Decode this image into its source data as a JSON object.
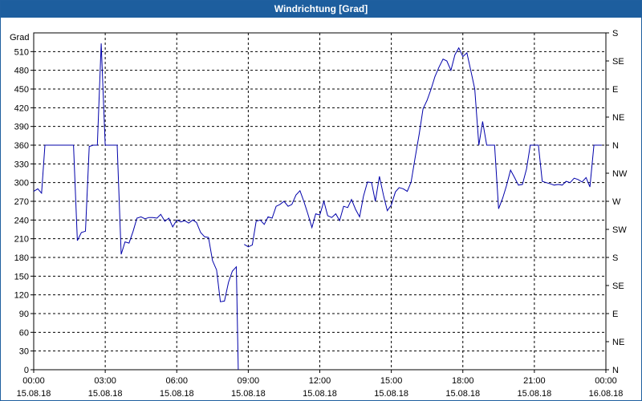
{
  "window": {
    "title": "Windrichtung [Grad]"
  },
  "colors": {
    "titlebar": "#1d5e9e",
    "line": "#0000aa",
    "grid": "#000000"
  },
  "chart_data": {
    "type": "line",
    "title": "Windrichtung [Grad]",
    "ylabel": "Grad",
    "ylim": [
      0,
      540
    ],
    "xlim": [
      0,
      24
    ],
    "grid": true,
    "y_ticks": [
      0,
      30,
      60,
      90,
      120,
      150,
      180,
      210,
      240,
      270,
      300,
      330,
      360,
      390,
      420,
      450,
      480,
      510
    ],
    "right_ticks": [
      {
        "value": 0,
        "label": "N"
      },
      {
        "value": 45,
        "label": "NE"
      },
      {
        "value": 90,
        "label": "E"
      },
      {
        "value": 135,
        "label": "SE"
      },
      {
        "value": 180,
        "label": "S"
      },
      {
        "value": 225,
        "label": "SW"
      },
      {
        "value": 270,
        "label": "W"
      },
      {
        "value": 315,
        "label": "NW"
      },
      {
        "value": 360,
        "label": "N"
      },
      {
        "value": 405,
        "label": "NE"
      },
      {
        "value": 450,
        "label": "E"
      },
      {
        "value": 495,
        "label": "SE"
      },
      {
        "value": 540,
        "label": "S"
      }
    ],
    "x_ticks": [
      {
        "value": 0,
        "time": "00:00",
        "date": "15.08.18"
      },
      {
        "value": 3,
        "time": "03:00",
        "date": "15.08.18"
      },
      {
        "value": 6,
        "time": "06:00",
        "date": "15.08.18"
      },
      {
        "value": 9,
        "time": "09:00",
        "date": "15.08.18"
      },
      {
        "value": 12,
        "time": "12:00",
        "date": "15.08.18"
      },
      {
        "value": 15,
        "time": "15:00",
        "date": "15.08.18"
      },
      {
        "value": 18,
        "time": "18:00",
        "date": "15.08.18"
      },
      {
        "value": 21,
        "time": "21:00",
        "date": "15.08.18"
      },
      {
        "value": 24,
        "time": "00:00",
        "date": "16.08.18"
      }
    ],
    "series": [
      {
        "segments": [
          [
            [
              0.0,
              286
            ],
            [
              0.17,
              290
            ],
            [
              0.33,
              283
            ],
            [
              0.47,
              360
            ],
            [
              0.67,
              360
            ],
            [
              1.0,
              360
            ],
            [
              1.33,
              360
            ],
            [
              1.67,
              360
            ],
            [
              1.83,
              207
            ],
            [
              2.0,
              220
            ],
            [
              2.17,
              222
            ],
            [
              2.33,
              358
            ],
            [
              2.5,
              360
            ],
            [
              2.67,
              360
            ],
            [
              2.83,
              523
            ],
            [
              3.0,
              360
            ],
            [
              3.17,
              360
            ],
            [
              3.33,
              360
            ],
            [
              3.5,
              360
            ],
            [
              3.67,
              185
            ],
            [
              3.83,
              205
            ],
            [
              4.0,
              203
            ],
            [
              4.17,
              222
            ],
            [
              4.33,
              243
            ],
            [
              4.5,
              245
            ],
            [
              4.67,
              242
            ],
            [
              4.83,
              244
            ],
            [
              5.0,
              244
            ],
            [
              5.17,
              243
            ],
            [
              5.33,
              249
            ],
            [
              5.5,
              238
            ],
            [
              5.67,
              243
            ],
            [
              5.83,
              229
            ],
            [
              6.0,
              240
            ],
            [
              6.17,
              237
            ],
            [
              6.33,
              239
            ],
            [
              6.5,
              235
            ],
            [
              6.67,
              240
            ],
            [
              6.83,
              236
            ],
            [
              7.0,
              220
            ],
            [
              7.17,
              213
            ],
            [
              7.33,
              212
            ],
            [
              7.5,
              175
            ],
            [
              7.67,
              160
            ],
            [
              7.83,
              109
            ],
            [
              8.0,
              110
            ],
            [
              8.17,
              140
            ],
            [
              8.33,
              158
            ],
            [
              8.5,
              165
            ],
            [
              8.58,
              0
            ]
          ],
          [
            [
              8.83,
              201
            ],
            [
              9.0,
              197
            ],
            [
              9.17,
              200
            ],
            [
              9.33,
              238
            ],
            [
              9.5,
              240
            ],
            [
              9.67,
              233
            ],
            [
              9.83,
              245
            ],
            [
              10.0,
              243
            ],
            [
              10.17,
              262
            ],
            [
              10.33,
              265
            ],
            [
              10.5,
              270
            ],
            [
              10.67,
              262
            ],
            [
              10.83,
              265
            ],
            [
              11.0,
              280
            ],
            [
              11.17,
              287
            ],
            [
              11.33,
              270
            ],
            [
              11.5,
              250
            ],
            [
              11.67,
              228
            ],
            [
              11.83,
              250
            ],
            [
              12.0,
              248
            ],
            [
              12.17,
              270
            ],
            [
              12.33,
              247
            ],
            [
              12.5,
              244
            ],
            [
              12.67,
              250
            ],
            [
              12.83,
              239
            ],
            [
              13.0,
              262
            ],
            [
              13.17,
              260
            ],
            [
              13.33,
              273
            ],
            [
              13.5,
              257
            ],
            [
              13.67,
              245
            ],
            [
              13.83,
              278
            ],
            [
              14.0,
              301
            ],
            [
              14.17,
              300
            ],
            [
              14.33,
              270
            ],
            [
              14.5,
              310
            ],
            [
              14.67,
              280
            ],
            [
              14.83,
              255
            ],
            [
              15.0,
              264
            ],
            [
              15.17,
              285
            ],
            [
              15.33,
              292
            ],
            [
              15.5,
              290
            ],
            [
              15.67,
              286
            ],
            [
              15.83,
              301
            ],
            [
              16.0,
              340
            ],
            [
              16.17,
              378
            ],
            [
              16.33,
              418
            ],
            [
              16.5,
              432
            ],
            [
              16.67,
              450
            ],
            [
              16.83,
              470
            ],
            [
              17.0,
              485
            ],
            [
              17.17,
              498
            ],
            [
              17.33,
              495
            ],
            [
              17.5,
              480
            ],
            [
              17.67,
              505
            ],
            [
              17.83,
              516
            ],
            [
              18.0,
              502
            ],
            [
              18.17,
              508
            ],
            [
              18.33,
              480
            ],
            [
              18.5,
              450
            ],
            [
              18.67,
              360
            ],
            [
              18.83,
              398
            ],
            [
              19.0,
              360
            ],
            [
              19.17,
              360
            ],
            [
              19.33,
              360
            ],
            [
              19.5,
              258
            ],
            [
              19.67,
              275
            ],
            [
              19.83,
              295
            ],
            [
              20.0,
              320
            ],
            [
              20.17,
              308
            ],
            [
              20.33,
              296
            ],
            [
              20.5,
              297
            ],
            [
              20.67,
              322
            ],
            [
              20.83,
              360
            ],
            [
              21.0,
              360
            ],
            [
              21.17,
              360
            ],
            [
              21.33,
              302
            ],
            [
              21.5,
              300
            ],
            [
              21.67,
              298
            ],
            [
              21.83,
              296
            ],
            [
              22.0,
              297
            ],
            [
              22.17,
              296
            ],
            [
              22.33,
              302
            ],
            [
              22.5,
              300
            ],
            [
              22.67,
              307
            ],
            [
              22.83,
              305
            ],
            [
              23.0,
              301
            ],
            [
              23.17,
              308
            ],
            [
              23.33,
              293
            ],
            [
              23.5,
              360
            ],
            [
              23.67,
              360
            ],
            [
              23.83,
              360
            ]
          ]
        ]
      }
    ]
  }
}
